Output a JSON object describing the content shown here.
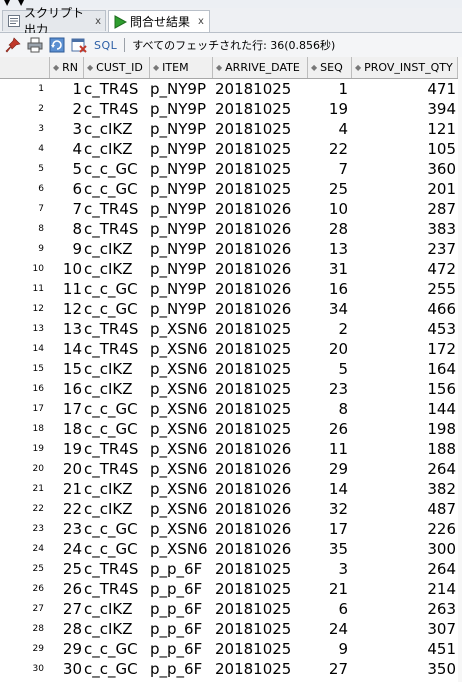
{
  "tabs": [
    {
      "label": "スクリプト出力",
      "close": "x",
      "active": false
    },
    {
      "label": "問合せ結果",
      "close": "x",
      "active": true
    }
  ],
  "toolbar": {
    "sql_label": "SQL",
    "status": "すべてのフェッチされた行: 36(0.856秒)"
  },
  "columns": [
    "RN",
    "CUST_ID",
    "ITEM",
    "ARRIVE_DATE",
    "SEQ",
    "PROV_INST_QTY"
  ],
  "rows": [
    {
      "n": "1",
      "rn": "1",
      "cust": "c_TR4S",
      "item": "p_NY9P",
      "date": "20181025",
      "seq": "1",
      "qty": "471"
    },
    {
      "n": "2",
      "rn": "2",
      "cust": "c_TR4S",
      "item": "p_NY9P",
      "date": "20181025",
      "seq": "19",
      "qty": "394"
    },
    {
      "n": "3",
      "rn": "3",
      "cust": "c_cIKZ",
      "item": "p_NY9P",
      "date": "20181025",
      "seq": "4",
      "qty": "121"
    },
    {
      "n": "4",
      "rn": "4",
      "cust": "c_cIKZ",
      "item": "p_NY9P",
      "date": "20181025",
      "seq": "22",
      "qty": "105"
    },
    {
      "n": "5",
      "rn": "5",
      "cust": "c_c_GC",
      "item": "p_NY9P",
      "date": "20181025",
      "seq": "7",
      "qty": "360"
    },
    {
      "n": "6",
      "rn": "6",
      "cust": "c_c_GC",
      "item": "p_NY9P",
      "date": "20181025",
      "seq": "25",
      "qty": "201"
    },
    {
      "n": "7",
      "rn": "7",
      "cust": "c_TR4S",
      "item": "p_NY9P",
      "date": "20181026",
      "seq": "10",
      "qty": "287"
    },
    {
      "n": "8",
      "rn": "8",
      "cust": "c_TR4S",
      "item": "p_NY9P",
      "date": "20181026",
      "seq": "28",
      "qty": "383"
    },
    {
      "n": "9",
      "rn": "9",
      "cust": "c_cIKZ",
      "item": "p_NY9P",
      "date": "20181026",
      "seq": "13",
      "qty": "237"
    },
    {
      "n": "10",
      "rn": "10",
      "cust": "c_cIKZ",
      "item": "p_NY9P",
      "date": "20181026",
      "seq": "31",
      "qty": "472"
    },
    {
      "n": "11",
      "rn": "11",
      "cust": "c_c_GC",
      "item": "p_NY9P",
      "date": "20181026",
      "seq": "16",
      "qty": "255"
    },
    {
      "n": "12",
      "rn": "12",
      "cust": "c_c_GC",
      "item": "p_NY9P",
      "date": "20181026",
      "seq": "34",
      "qty": "466"
    },
    {
      "n": "13",
      "rn": "13",
      "cust": "c_TR4S",
      "item": "p_XSN6",
      "date": "20181025",
      "seq": "2",
      "qty": "453"
    },
    {
      "n": "14",
      "rn": "14",
      "cust": "c_TR4S",
      "item": "p_XSN6",
      "date": "20181025",
      "seq": "20",
      "qty": "172"
    },
    {
      "n": "15",
      "rn": "15",
      "cust": "c_cIKZ",
      "item": "p_XSN6",
      "date": "20181025",
      "seq": "5",
      "qty": "164"
    },
    {
      "n": "16",
      "rn": "16",
      "cust": "c_cIKZ",
      "item": "p_XSN6",
      "date": "20181025",
      "seq": "23",
      "qty": "156"
    },
    {
      "n": "17",
      "rn": "17",
      "cust": "c_c_GC",
      "item": "p_XSN6",
      "date": "20181025",
      "seq": "8",
      "qty": "144"
    },
    {
      "n": "18",
      "rn": "18",
      "cust": "c_c_GC",
      "item": "p_XSN6",
      "date": "20181025",
      "seq": "26",
      "qty": "198"
    },
    {
      "n": "19",
      "rn": "19",
      "cust": "c_TR4S",
      "item": "p_XSN6",
      "date": "20181026",
      "seq": "11",
      "qty": "188"
    },
    {
      "n": "20",
      "rn": "20",
      "cust": "c_TR4S",
      "item": "p_XSN6",
      "date": "20181026",
      "seq": "29",
      "qty": "264"
    },
    {
      "n": "21",
      "rn": "21",
      "cust": "c_cIKZ",
      "item": "p_XSN6",
      "date": "20181026",
      "seq": "14",
      "qty": "382"
    },
    {
      "n": "22",
      "rn": "22",
      "cust": "c_cIKZ",
      "item": "p_XSN6",
      "date": "20181026",
      "seq": "32",
      "qty": "487"
    },
    {
      "n": "23",
      "rn": "23",
      "cust": "c_c_GC",
      "item": "p_XSN6",
      "date": "20181026",
      "seq": "17",
      "qty": "226"
    },
    {
      "n": "24",
      "rn": "24",
      "cust": "c_c_GC",
      "item": "p_XSN6",
      "date": "20181026",
      "seq": "35",
      "qty": "300"
    },
    {
      "n": "25",
      "rn": "25",
      "cust": "c_TR4S",
      "item": "p_p_6F",
      "date": "20181025",
      "seq": "3",
      "qty": "264"
    },
    {
      "n": "26",
      "rn": "26",
      "cust": "c_TR4S",
      "item": "p_p_6F",
      "date": "20181025",
      "seq": "21",
      "qty": "214"
    },
    {
      "n": "27",
      "rn": "27",
      "cust": "c_cIKZ",
      "item": "p_p_6F",
      "date": "20181025",
      "seq": "6",
      "qty": "263"
    },
    {
      "n": "28",
      "rn": "28",
      "cust": "c_cIKZ",
      "item": "p_p_6F",
      "date": "20181025",
      "seq": "24",
      "qty": "307"
    },
    {
      "n": "29",
      "rn": "29",
      "cust": "c_c_GC",
      "item": "p_p_6F",
      "date": "20181025",
      "seq": "9",
      "qty": "451"
    },
    {
      "n": "30",
      "rn": "30",
      "cust": "c_c_GC",
      "item": "p_p_6F",
      "date": "20181025",
      "seq": "27",
      "qty": "350"
    }
  ],
  "icons": {
    "script_tab": "script-output-icon",
    "result_tab": "run-triangle-icon",
    "pin": "pin-icon",
    "print": "print-icon",
    "refresh": "refresh-icon",
    "export": "export-icon"
  },
  "colors": {
    "pin": "#c0392b",
    "run": "#2f9e2f",
    "sql": "#2d5fa6"
  }
}
